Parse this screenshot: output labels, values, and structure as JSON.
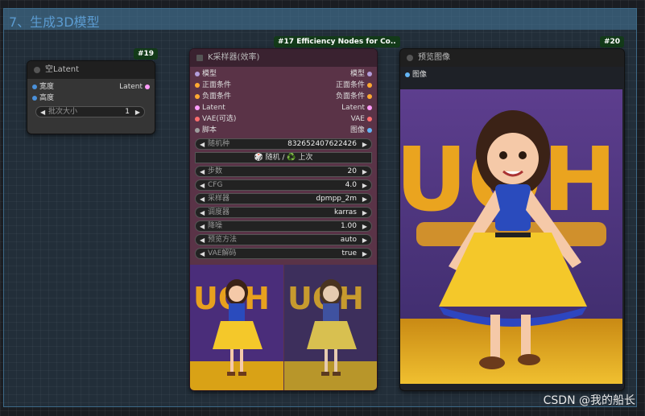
{
  "group": {
    "title": "7、生成3D模型"
  },
  "nodes": {
    "latent": {
      "id": "#19",
      "title": "空Latent",
      "inputs": [
        "宽度",
        "高度"
      ],
      "output": "Latent",
      "widget": {
        "label": "批次大小",
        "value": "1"
      }
    },
    "ksampler": {
      "id": "#17 Efficiency Nodes for Co..",
      "title": "K采样器(效率)",
      "slots": [
        {
          "in": "模型",
          "out": "模型",
          "in_color": "#b39ddb",
          "out_color": "#b39ddb"
        },
        {
          "in": "正面条件",
          "out": "正面条件",
          "in_color": "#ffa931",
          "out_color": "#ffa931"
        },
        {
          "in": "负面条件",
          "out": "负面条件",
          "in_color": "#ffa931",
          "out_color": "#ffa931"
        },
        {
          "in": "Latent",
          "out": "Latent",
          "in_color": "#ff9cf9",
          "out_color": "#ff9cf9"
        },
        {
          "in": "VAE(可选)",
          "out": "VAE",
          "in_color": "#ff6e6e",
          "out_color": "#ff6e6e"
        },
        {
          "in": "脚本",
          "out": "图像",
          "in_color": "#9e9e9e",
          "out_color": "#64b5f6"
        }
      ],
      "seed": {
        "label": "随机种",
        "value": "832652407622426"
      },
      "seed_button": "🎲 随机 / ♻️ 上次",
      "widgets": [
        {
          "label": "步数",
          "value": "20"
        },
        {
          "label": "CFG",
          "value": "4.0"
        },
        {
          "label": "采样器",
          "value": "dpmpp_2m"
        },
        {
          "label": "调度器",
          "value": "karras"
        },
        {
          "label": "降噪",
          "value": "1.00"
        },
        {
          "label": "预览方法",
          "value": "auto"
        },
        {
          "label": "VAE解码",
          "value": "true"
        }
      ]
    },
    "preview": {
      "id": "#20",
      "title": "预览图像",
      "input": "图像"
    }
  },
  "watermark": "CSDN @我的船长",
  "colors": {
    "group_bg": "#2e4c63",
    "node_bg": "#353535",
    "ksampler_bg": "#5a3347",
    "id_badge": "#133a19"
  }
}
